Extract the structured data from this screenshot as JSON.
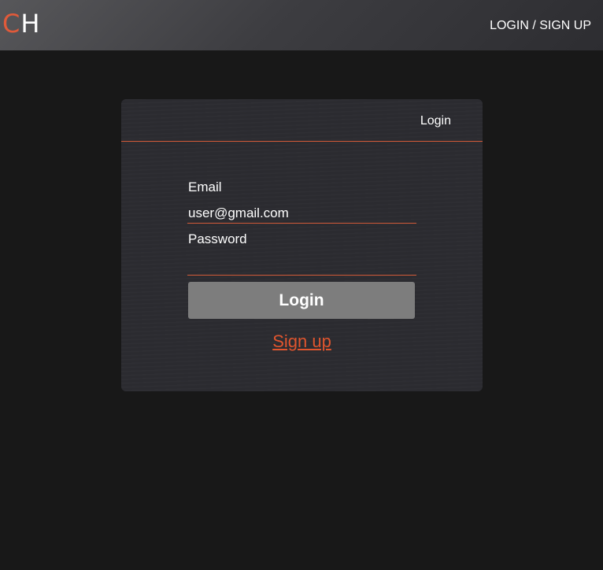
{
  "navbar": {
    "logo_first": "C",
    "logo_second": "H",
    "nav_link": "LOGIN / SIGN UP"
  },
  "card": {
    "tab": "Login",
    "email_label": "Email",
    "email_value": "user@gmail.com",
    "password_label": "Password",
    "password_value": "",
    "login_button": "Login",
    "signup_link": "Sign up"
  },
  "colors": {
    "accent": "#e05a3a",
    "background": "#181818",
    "card": "#2b2b30",
    "button": "#7d7d7d"
  }
}
